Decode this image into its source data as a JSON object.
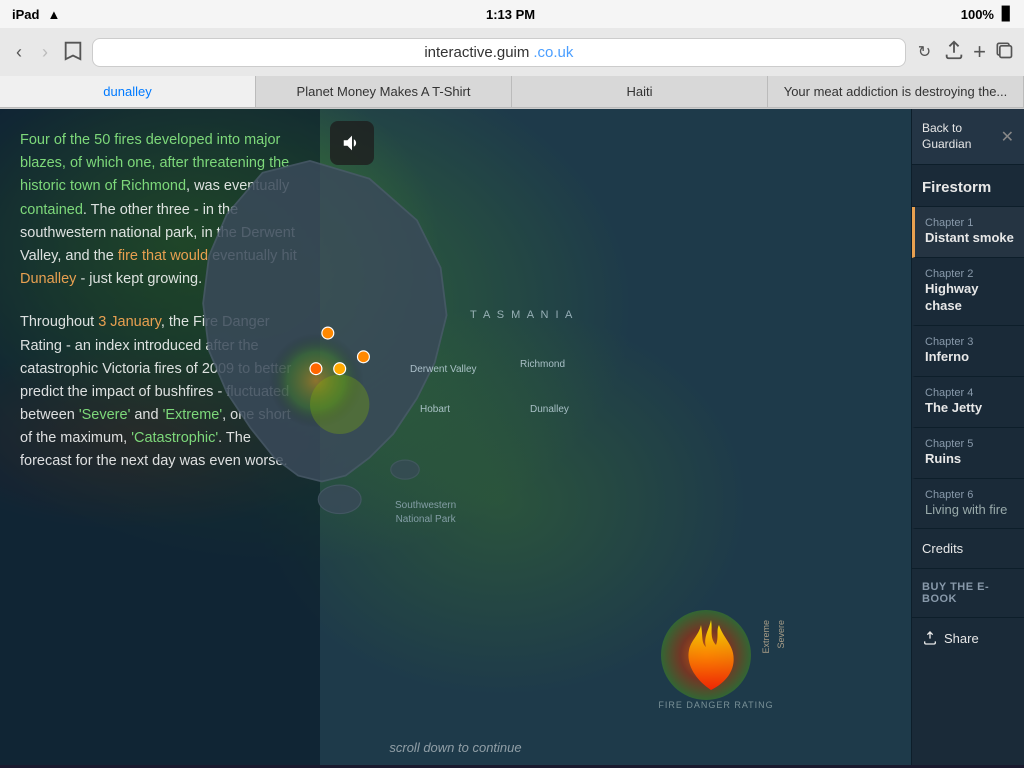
{
  "statusBar": {
    "device": "iPad",
    "wifi": true,
    "time": "1:13 PM",
    "battery": "100%"
  },
  "browserChrome": {
    "back": "‹",
    "forward": "›",
    "bookmark": "📖",
    "url": "interactive.guim.co.uk",
    "urlDomain": "interactive.guim",
    "urlTld": ".co.uk",
    "reload": "↻",
    "share": "⬆",
    "add": "+",
    "tabs": "⧉"
  },
  "tabs": [
    {
      "label": "dunalley",
      "active": true
    },
    {
      "label": "Planet Money Makes A T-Shirt",
      "active": false
    },
    {
      "label": "Haiti",
      "active": false
    },
    {
      "label": "Your meat addiction is destroying the...",
      "active": false
    }
  ],
  "audio": {
    "icon": "🔊"
  },
  "articleText": {
    "paragraph1": "Four of the 50 fires developed into major blazes, of which one, after threatening the historic town of Richmond, was eventually contained. The other three - in the southwestern national park, in the Derwent Valley, and the fire that would eventually hit Dunalley - just kept growing.",
    "paragraph2": "Throughout 3 January, the Fire Danger Rating - an index introduced after the catastrophic Victoria fires of 2009 to better predict the impact of bushfires - fluctuated between 'Severe' and 'Extreme', one short of the maximum, 'Catastrophic'. The forecast for the next day was even worse.",
    "scrollHint": "scroll down to continue"
  },
  "mapLabels": {
    "tasmania": "T A S M A N I A",
    "derwentValley": "Derwent Valley",
    "hobart": "Hobart",
    "richmond": "Richmond",
    "dunalley": "Dunalley",
    "swNationalPark": "Southwestern\nNational Park",
    "fireDangerRating": "FIRE DANGER RATING",
    "severe": "Severe",
    "extreme": "Extreme"
  },
  "sidebar": {
    "backLabel": "Back to Guardian",
    "closeLabel": "✕",
    "title": "Firestorm",
    "chapters": [
      {
        "num": "Chapter 1",
        "name": "Distant smoke",
        "active": true
      },
      {
        "num": "Chapter 2",
        "name": "Highway chase",
        "active": false
      },
      {
        "num": "Chapter 3",
        "name": "Inferno",
        "active": false
      },
      {
        "num": "Chapter 4",
        "name": "The Jetty",
        "active": false
      },
      {
        "num": "Chapter 5",
        "name": "Ruins",
        "active": false
      },
      {
        "num": "Chapter 6",
        "name": "Living with fire",
        "active": false,
        "muted": true
      }
    ],
    "credits": "Credits",
    "buyEbook": "BUY THE E-BOOK",
    "share": "Share"
  }
}
